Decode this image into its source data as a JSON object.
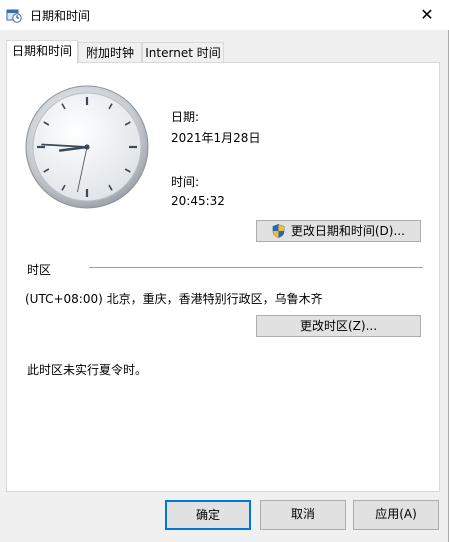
{
  "window": {
    "title": "日期和时间",
    "close_symbol": "✕"
  },
  "tabs": [
    {
      "label": "日期和时间"
    },
    {
      "label": "附加时钟"
    },
    {
      "label": "Internet 时间"
    }
  ],
  "datetime": {
    "date_label": "日期:",
    "date_value": "2021年1月28日",
    "time_label": "时间:",
    "time_value": "20:45:32",
    "change_btn_label": "更改日期和时间(D)..."
  },
  "timezone": {
    "section_label": "时区",
    "value": "(UTC+08:00) 北京，重庆，香港特别行政区，乌鲁木齐",
    "change_btn_label": "更改时区(Z)...",
    "dst_note": "此时区未实行夏令时。"
  },
  "footer": {
    "ok_label": "确定",
    "cancel_label": "取消",
    "apply_label": "应用(A)"
  },
  "clock": {
    "hour": 20,
    "minute": 45,
    "second": 32
  },
  "colors": {
    "accent": "#0078d7",
    "button_bg": "#e1e1e1",
    "window_bg": "#f0f0f0"
  },
  "icons": [
    "calendar-clock-icon",
    "close-icon",
    "uac-shield-icon"
  ]
}
